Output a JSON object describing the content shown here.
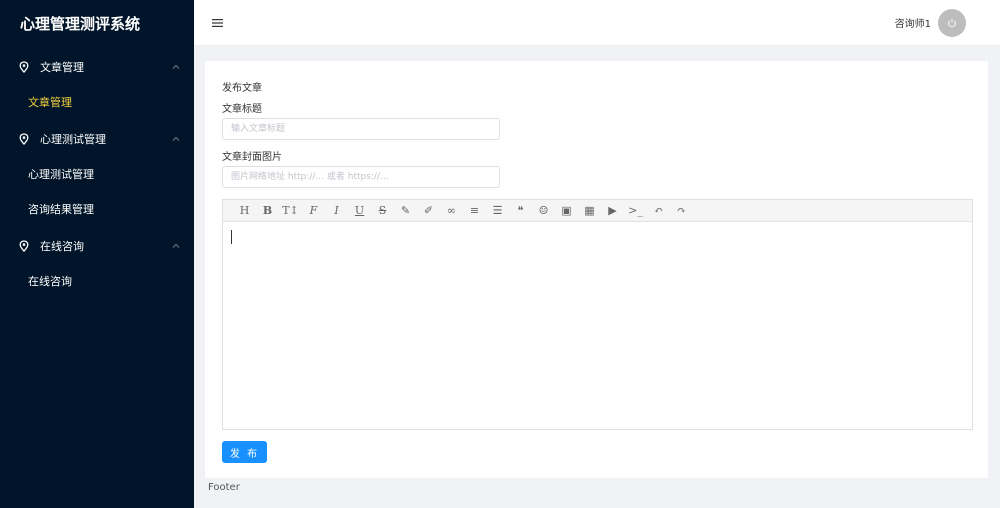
{
  "app": {
    "title": "心理管理测评系统"
  },
  "sidebar": {
    "groups": [
      {
        "label": "文章管理",
        "items": [
          {
            "label": "文章管理",
            "active": true
          }
        ]
      },
      {
        "label": "心理测试管理",
        "items": [
          {
            "label": "心理测试管理"
          },
          {
            "label": "咨询结果管理"
          }
        ]
      },
      {
        "label": "在线咨询",
        "items": [
          {
            "label": "在线咨询"
          }
        ]
      }
    ]
  },
  "header": {
    "user_name": "咨询师1"
  },
  "form": {
    "page_title": "发布文章",
    "title_label": "文章标题",
    "title_placeholder": "输入文章标题",
    "cover_label": "文章封面图片",
    "cover_placeholder": "图片网络地址 http://... 或者 https://...",
    "publish_label": "发 布"
  },
  "editor": {
    "toolbar": [
      {
        "name": "heading",
        "glyph": "H"
      },
      {
        "name": "bold",
        "glyph": "B"
      },
      {
        "name": "text-size",
        "glyph": "T↕"
      },
      {
        "name": "font",
        "glyph": "F"
      },
      {
        "name": "italic",
        "glyph": "I"
      },
      {
        "name": "underline",
        "glyph": "U"
      },
      {
        "name": "strikethrough",
        "glyph": "S"
      },
      {
        "name": "marker",
        "glyph": "✎"
      },
      {
        "name": "brush",
        "glyph": "✐"
      },
      {
        "name": "link",
        "glyph": "∞"
      },
      {
        "name": "unordered-list",
        "glyph": "≡"
      },
      {
        "name": "align",
        "glyph": "☰"
      },
      {
        "name": "quote",
        "glyph": "❝"
      },
      {
        "name": "emoji",
        "glyph": "☺"
      },
      {
        "name": "image",
        "glyph": "▣"
      },
      {
        "name": "table",
        "glyph": "▦"
      },
      {
        "name": "video",
        "glyph": "▶"
      },
      {
        "name": "code",
        "glyph": ">_"
      },
      {
        "name": "undo",
        "glyph": "↶"
      },
      {
        "name": "redo",
        "glyph": "↷"
      }
    ]
  },
  "footer": {
    "text": "Footer"
  },
  "colors": {
    "sidebar_bg": "#001529",
    "active_menu": "#f5d040",
    "primary": "#1890ff"
  }
}
